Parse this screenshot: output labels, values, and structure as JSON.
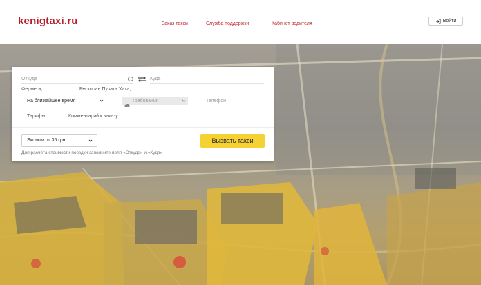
{
  "header": {
    "logo": "kenigtaxi.ru",
    "nav": [
      "Заказ такси",
      "Служба поддержки",
      "Кабинет водителя"
    ],
    "login_label": "Войти"
  },
  "form": {
    "from_placeholder": "Откуда",
    "to_placeholder": "Куда",
    "suggestions": [
      "Фермеги,",
      "Ресторан Пузата Хата,"
    ],
    "time_value": "На ближайшее время",
    "requirements_placeholder": "Требования",
    "phone_placeholder": "Телефон",
    "tabs": [
      "Тарифы",
      "Комментарий к заказу"
    ],
    "tariff_value": "Эконом от 35 грн",
    "call_button": "Вызвать такси",
    "hint": "Для расчёта стоимости поездки заполните поля «Откуда» и «Куда»"
  },
  "colors": {
    "brand_red": "#b5202e",
    "call_yellow": "#f5d234"
  },
  "icons": [
    "login-icon",
    "location-circle-icon",
    "swap-arrows-icon",
    "chevron-down-icon",
    "car-icon"
  ]
}
